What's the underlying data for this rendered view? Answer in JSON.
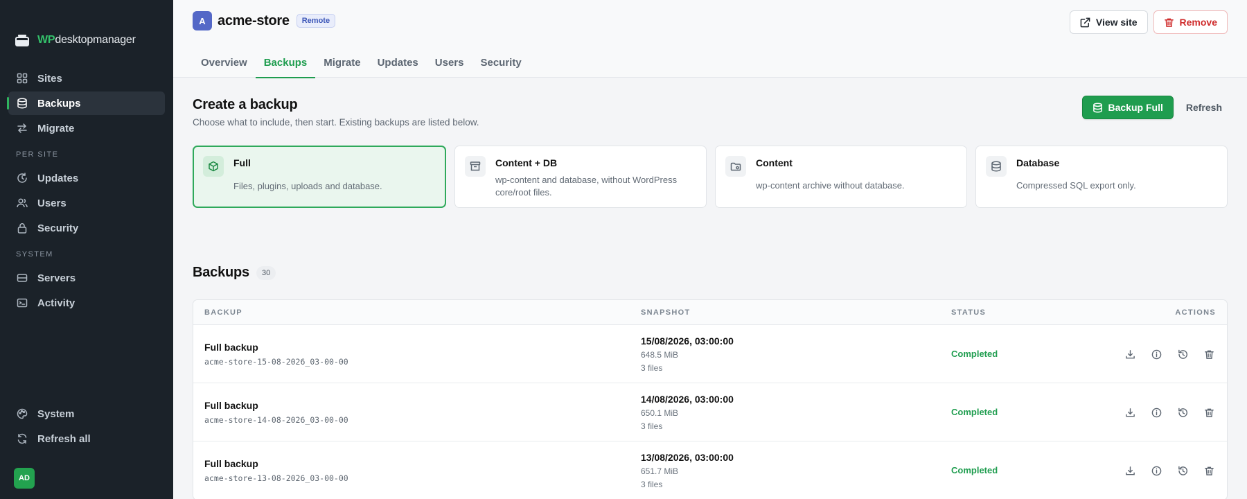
{
  "brand": {
    "prefix": "WP",
    "name": "desktopmanager"
  },
  "sidebar": {
    "main_items": [
      {
        "label": "Sites",
        "icon": "grid-icon",
        "active": false
      },
      {
        "label": "Backups",
        "icon": "database-icon",
        "active": true
      },
      {
        "label": "Migrate",
        "icon": "arrows-swap-icon",
        "active": false
      }
    ],
    "sections": [
      {
        "label": "PER SITE",
        "items": [
          {
            "label": "Updates",
            "icon": "refresh-clock-icon"
          },
          {
            "label": "Users",
            "icon": "users-icon"
          },
          {
            "label": "Security",
            "icon": "lock-icon"
          }
        ]
      },
      {
        "label": "SYSTEM",
        "items": [
          {
            "label": "Servers",
            "icon": "server-icon"
          },
          {
            "label": "Activity",
            "icon": "terminal-icon"
          }
        ]
      }
    ],
    "bottom_items": [
      {
        "label": "System",
        "icon": "palette-icon"
      },
      {
        "label": "Refresh all",
        "icon": "refresh-icon"
      }
    ],
    "user_initials": "AD"
  },
  "site": {
    "avatar": "A",
    "name": "acme-store",
    "badge": "Remote"
  },
  "top_actions": {
    "view_site": "View site",
    "remove": "Remove"
  },
  "tabs": [
    {
      "label": "Overview",
      "active": false
    },
    {
      "label": "Backups",
      "active": true
    },
    {
      "label": "Migrate",
      "active": false
    },
    {
      "label": "Updates",
      "active": false
    },
    {
      "label": "Users",
      "active": false
    },
    {
      "label": "Security",
      "active": false
    }
  ],
  "create": {
    "title": "Create a backup",
    "subtitle": "Choose what to include, then start. Existing backups are listed below.",
    "primary_button": "Backup Full",
    "refresh_button": "Refresh",
    "options": [
      {
        "title": "Full",
        "desc": "Files, plugins, uploads and database.",
        "icon": "cube-icon",
        "selected": true
      },
      {
        "title": "Content + DB",
        "desc": "wp-content and database, without WordPress core/root files.",
        "icon": "archive-icon",
        "selected": false
      },
      {
        "title": "Content",
        "desc": "wp-content archive without database.",
        "icon": "folder-cog-icon",
        "selected": false
      },
      {
        "title": "Database",
        "desc": "Compressed SQL export only.",
        "icon": "database-icon",
        "selected": false
      }
    ]
  },
  "backups": {
    "title": "Backups",
    "count": "30",
    "columns": {
      "backup": "BACKUP",
      "snapshot": "SNAPSHOT",
      "status": "STATUS",
      "actions": "ACTIONS"
    },
    "rows": [
      {
        "name": "Full backup",
        "id": "acme-store-15-08-2026_03-00-00",
        "date": "15/08/2026, 03:00:00",
        "size": "648.5 MiB",
        "files": "3 files",
        "status": "Completed"
      },
      {
        "name": "Full backup",
        "id": "acme-store-14-08-2026_03-00-00",
        "date": "14/08/2026, 03:00:00",
        "size": "650.1 MiB",
        "files": "3 files",
        "status": "Completed"
      },
      {
        "name": "Full backup",
        "id": "acme-store-13-08-2026_03-00-00",
        "date": "13/08/2026, 03:00:00",
        "size": "651.7 MiB",
        "files": "3 files",
        "status": "Completed"
      }
    ]
  },
  "colors": {
    "accent": "#1f9d4f",
    "sidebar_bg": "#1b2229",
    "danger": "#cf2b2b",
    "site_avatar": "#5468c7"
  }
}
